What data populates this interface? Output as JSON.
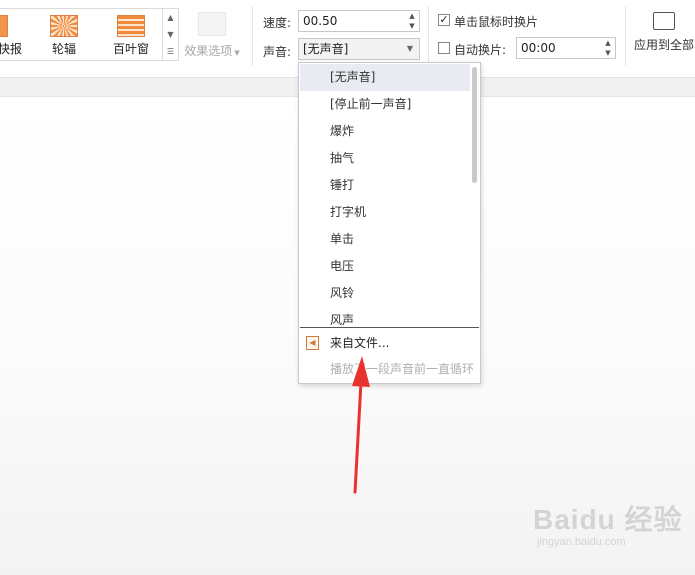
{
  "ribbon": {
    "transitions": [
      {
        "label": "快报"
      },
      {
        "label": "轮辐"
      },
      {
        "label": "百叶窗"
      }
    ],
    "effect_options_label": "效果选项",
    "speed_label": "速度:",
    "speed_value": "00.50",
    "sound_label": "声音:",
    "sound_value": "[无声音]",
    "click_advance_label": "单击鼠标时换片",
    "click_advance_checked": true,
    "auto_advance_label": "自动换片:",
    "auto_advance_checked": false,
    "auto_advance_value": "00:00",
    "apply_all_label": "应用到全部"
  },
  "sound_dropdown": {
    "items": [
      "[无声音]",
      "[停止前一声音]",
      "爆炸",
      "抽气",
      "锤打",
      "打字机",
      "单击",
      "电压",
      "风铃",
      "风声"
    ],
    "selected_index": 0,
    "from_file_label": "来自文件...",
    "loop_label": "播放下一段声音前一直循环"
  },
  "watermark": {
    "brand": "Baidu 经验",
    "url": "jingyan.baidu.com"
  },
  "colors": {
    "accent_orange": "#f08a3c",
    "annotation_red": "#e8322f",
    "selection_bg": "#e8ecf2"
  }
}
